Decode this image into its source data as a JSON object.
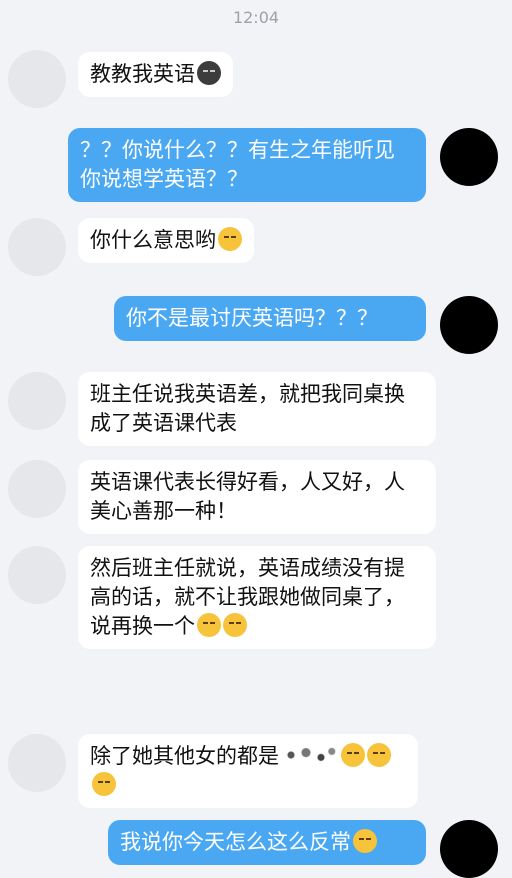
{
  "status_time": "12:04",
  "messages": [
    {
      "side": "in",
      "text": "教教我英语",
      "emoji": "smirk-moon-emoji"
    },
    {
      "side": "out",
      "text": "？？你说什么？？有生之年能听见你说想学英语？？"
    },
    {
      "side": "in",
      "text": "你什么意思哟",
      "emoji": "upside-down-face-emoji"
    },
    {
      "side": "out",
      "text": "你不是最讨厌英语吗？？？"
    },
    {
      "side": "in",
      "text": "班主任说我英语差，就把我同桌换成了英语课代表"
    },
    {
      "side": "in",
      "text": "英语课代表长得好看，人又好，人美心善那一种！"
    },
    {
      "side": "in",
      "text": "然后班主任就说，英语成绩没有提高的话，就不让我跟她做同桌了，说再换一个",
      "emoji": "unamused-face-emoji-x2"
    },
    {
      "side": "in",
      "text": "除了她其他女的都是",
      "emoji": "unamused-face-emoji-x3"
    },
    {
      "side": "out",
      "text": "我说你今天怎么这么反常",
      "emoji": "unamused-face-emoji"
    }
  ]
}
